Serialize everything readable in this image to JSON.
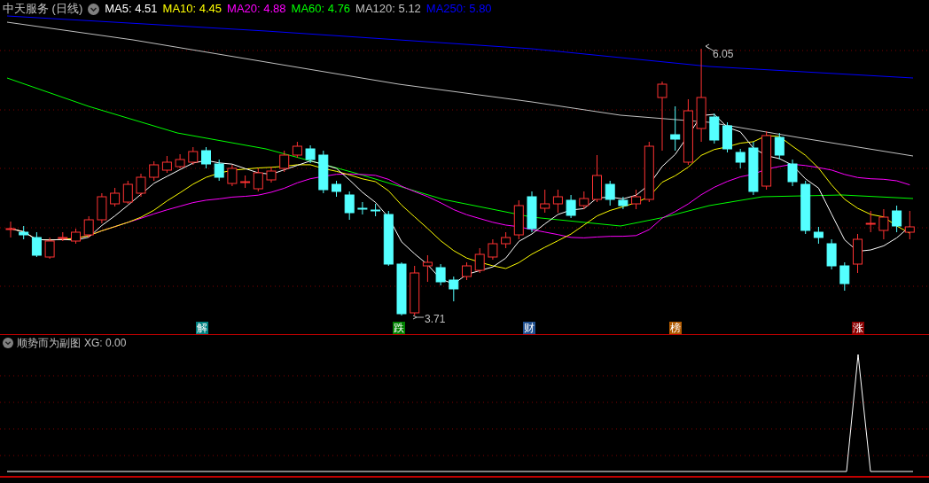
{
  "header": {
    "title": "中天服务 (日线)",
    "indicators": [
      {
        "label": "MA5:",
        "value": "4.51",
        "color": "#ffffff"
      },
      {
        "label": "MA10:",
        "value": "4.45",
        "color": "#ffff00"
      },
      {
        "label": "MA20:",
        "value": "4.88",
        "color": "#ff00ff"
      },
      {
        "label": "MA60:",
        "value": "4.76",
        "color": "#00ff00"
      },
      {
        "label": "MA120:",
        "value": "5.12",
        "color": "#c0c0c0"
      },
      {
        "label": "MA250:",
        "value": "5.80",
        "color": "#0000ff"
      }
    ]
  },
  "price_labels": {
    "high": "6.05",
    "low": "3.71"
  },
  "event_markers": [
    {
      "text": "解",
      "color": "#008080"
    },
    {
      "text": "跌",
      "color": "#008000"
    },
    {
      "text": "财",
      "color": "#1f4f8f"
    },
    {
      "text": "榜",
      "color": "#b05a00"
    },
    {
      "text": "涨",
      "color": "#8b0000"
    }
  ],
  "sub_chart": {
    "title": "顺势而为副图",
    "indicators": [
      {
        "label": "XG:",
        "value": "0.00",
        "color": "#c0c0c0"
      }
    ]
  }
}
